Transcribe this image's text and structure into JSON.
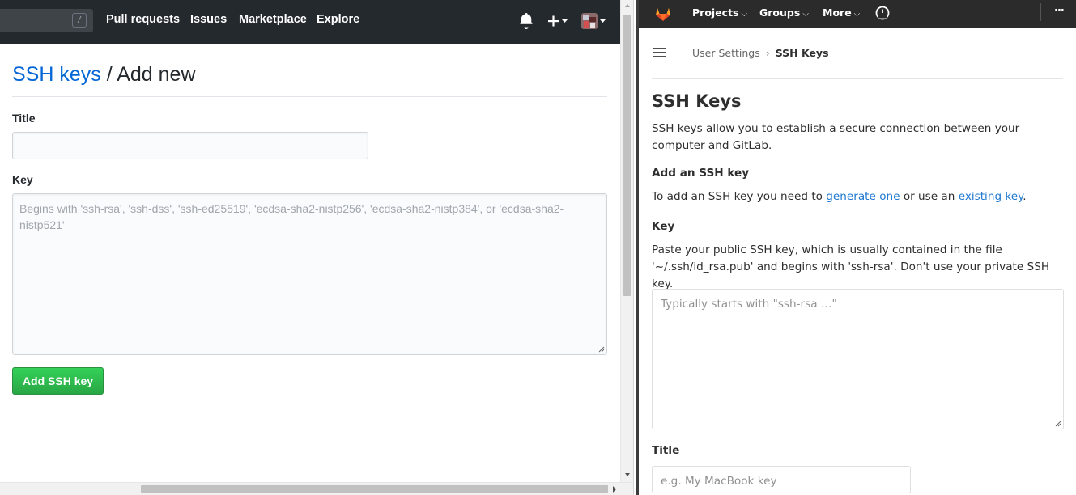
{
  "github": {
    "header": {
      "search_shortcut": "/",
      "nav": [
        "Pull requests",
        "Issues",
        "Marketplace",
        "Explore"
      ],
      "icons": [
        "bell-icon",
        "plus-icon",
        "avatar"
      ]
    },
    "title_link": "SSH keys",
    "title_rest": " / Add new",
    "form": {
      "title_label": "Title",
      "title_value": "",
      "key_label": "Key",
      "key_placeholder": "Begins with 'ssh-rsa', 'ssh-dss', 'ssh-ed25519', 'ecdsa-sha2-nistp256', 'ecdsa-sha2-nistp384', or 'ecdsa-sha2-nistp521'",
      "submit_label": "Add SSH key"
    },
    "colors": {
      "header_bg": "#24292e",
      "link": "#0366d6",
      "button": "#28a745"
    }
  },
  "gitlab": {
    "header": {
      "nav": [
        "Projects",
        "Groups",
        "More"
      ],
      "more_dots": "···",
      "icons": [
        "gitlab-logo",
        "gauge-icon"
      ]
    },
    "breadcrumb": {
      "parent": "User Settings",
      "current": "SSH Keys"
    },
    "heading": "SSH Keys",
    "intro": "SSH keys allow you to establish a secure connection between your computer and GitLab.",
    "add_heading": "Add an SSH key",
    "add_text_before": "To add an SSH key you need to ",
    "add_link_generate": "generate one",
    "add_text_middle": " or use an ",
    "add_link_existing": "existing key",
    "add_text_after": ".",
    "key_label": "Key",
    "key_help": "Paste your public SSH key, which is usually contained in the file '~/.ssh/id_rsa.pub' and begins with 'ssh-rsa'. Don't use your private SSH key.",
    "key_placeholder": "Typically starts with \"ssh-rsa …\"",
    "title_label": "Title",
    "title_placeholder": "e.g. My MacBook key",
    "colors": {
      "header_bg": "#2b2b2b",
      "link": "#1f78d1",
      "logo": "#e24329"
    }
  }
}
